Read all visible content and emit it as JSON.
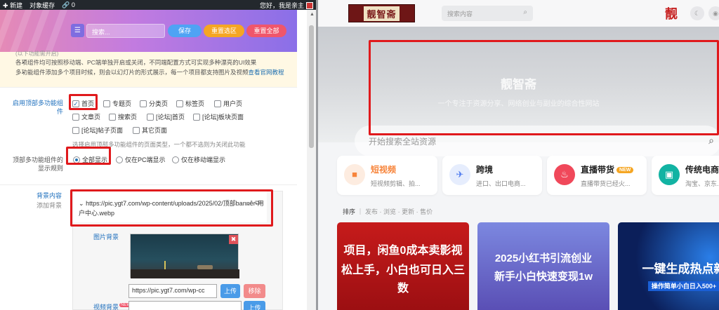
{
  "adminbar": {
    "new_label": "新建",
    "cache_label": "对象缓存",
    "link_count": "0",
    "greeting": "您好，我是亲主"
  },
  "options": {
    "search_placeholder": "搜索...",
    "save_label": "保存",
    "reset_selection_label": "重置选区",
    "reset_all_label": "重置全部"
  },
  "notice": {
    "cut_text": "(以下功能需开启)",
    "line1": "各项组件均可按照移动端、PC端单独开启或关闭，不同端配置方式可实现多种漂亮的UI效果",
    "line2": "多功能组件添加多个项目时候，则会以幻灯片的形式展示，每一个项目都支持图片及视频",
    "line2_link": "查看官网教程"
  },
  "multi_component": {
    "label": "启用顶部多功能组件",
    "pages": [
      "首页",
      "专题页",
      "分类页",
      "标签页",
      "用户页",
      "文章页",
      "搜索页",
      "[论坛]首页",
      "[论坛]板块页面",
      "[论坛]帖子页面",
      "其它页面"
    ],
    "checked": [
      "首页"
    ],
    "description": "选择启用顶部多功能组件的页面类型，一个都不选则为关闭此功能"
  },
  "display_rule": {
    "label": "顶部多功能组件的显示规则",
    "options": [
      "全部显示",
      "仅在PC端显示",
      "仅在移动端显示"
    ],
    "selected": "全部显示"
  },
  "background": {
    "label": "背景内容",
    "sublabel": "添加背景",
    "item_url": "https://pic.ygt7.com/wp-content/uploads/2025/02/顶部banner-用户中心.webp",
    "image_label": "图片背景",
    "url_value": "https://pic.ygt7.com/wp-cc",
    "upload_label": "上传",
    "remove_label": "移除",
    "video_label": "视频背景",
    "video_badge": "NEW"
  },
  "site": {
    "logo_text": "靓智斋",
    "search_placeholder": "搜索内容",
    "brand_glyph": "靓",
    "hero_title": "靓智斋",
    "hero_subtitle": "一个专注于资源分享、网络创业与副业的综合性网站",
    "hero_search_placeholder": "开始搜索全站资源"
  },
  "categories": [
    {
      "title": "短视频",
      "subtitle": "短视频剪辑、拍...",
      "color": "#f7843a",
      "icon": "video-camera-icon"
    },
    {
      "title": "跨境",
      "subtitle": "进口、出口电商...",
      "color": "#4f7bef",
      "icon": "airplane-icon"
    },
    {
      "title": "直播带货",
      "subtitle": "直播带货已经火...",
      "color": "#f0485a",
      "icon": "flame-icon",
      "badge": "NEW"
    },
    {
      "title": "传统电商",
      "subtitle": "淘宝、京东...",
      "color": "#12b3a3",
      "icon": "shop-icon"
    }
  ],
  "sort": {
    "label": "排序",
    "items": [
      "发布",
      "浏览",
      "更新",
      "售价"
    ]
  },
  "posts": [
    {
      "line1": "项目，闲鱼0成本卖影视",
      "line2": "松上手，小白也可日入三",
      "line3": "数"
    },
    {
      "line1": "2025小红书引流创业",
      "line2": "新手小白快速变现1w"
    },
    {
      "line1": "一键生成热点新",
      "line2": "操作简单小白日入500+"
    }
  ]
}
